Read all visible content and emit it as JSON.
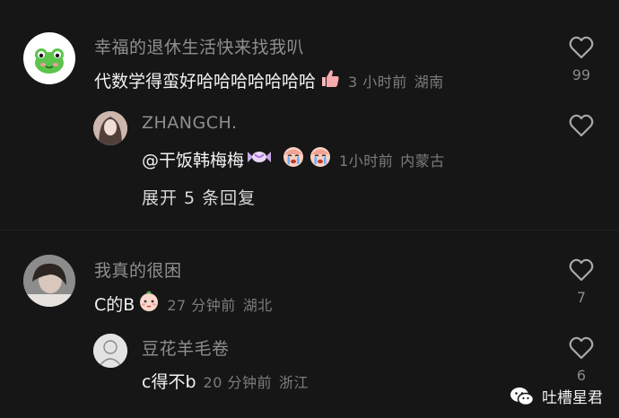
{
  "comments": [
    {
      "username": "幸福的退休生活快来找我叭",
      "text": "代数学得蛮好哈哈哈哈哈哈哈",
      "time": "3 小时前",
      "location": "湖南",
      "likes": "99",
      "reply": {
        "username": "ZHANGCH.",
        "text": "@干饭韩梅梅",
        "time": "1小时前",
        "location": "内蒙古"
      },
      "expand_label": "展开 5 条回复"
    },
    {
      "username": "我真的很困",
      "text": "C的B",
      "time": "27 分钟前",
      "location": "湖北",
      "likes": "7",
      "reply": {
        "username": "豆花羊毛卷",
        "text": "c得不b",
        "time": "20 分钟前",
        "location": "浙江",
        "likes": "6"
      }
    }
  ],
  "watermark": {
    "text": "吐槽星君"
  },
  "icons": {
    "like": "heart-outline-icon",
    "emoji_1": "thumbs-up-emoji",
    "emoji_2": "candy-emoji",
    "emoji_3": "crying-face-emoji",
    "emoji_4": "baby-face-emoji",
    "watermark": "wechat-icon"
  }
}
